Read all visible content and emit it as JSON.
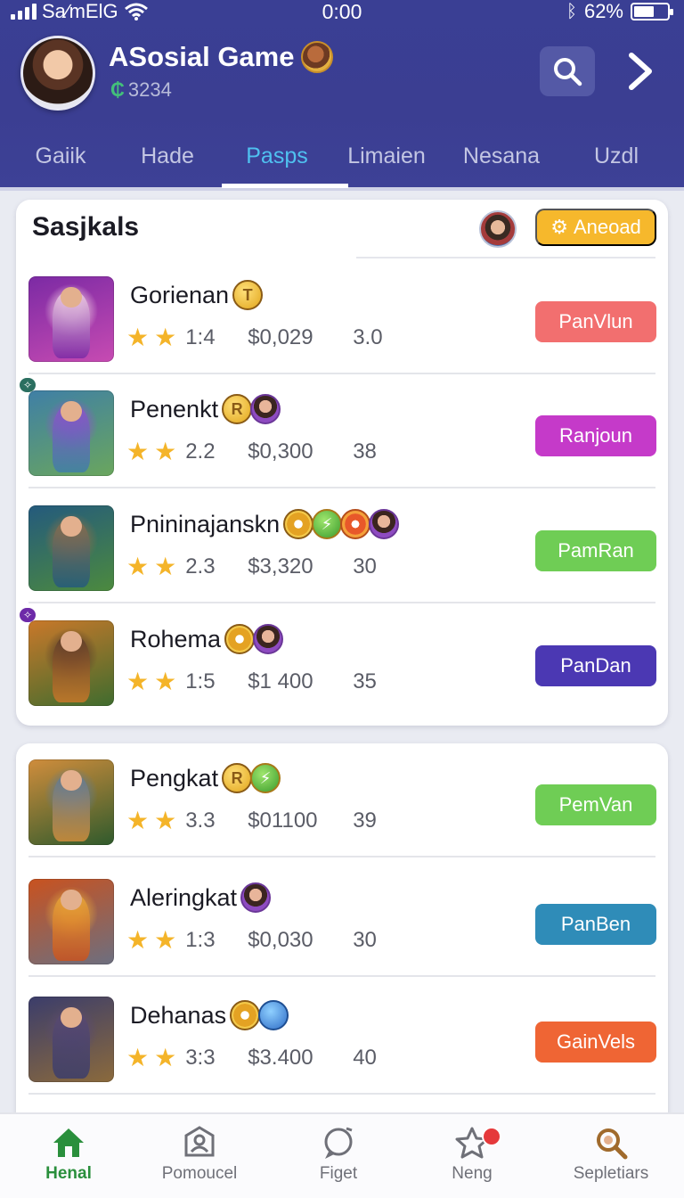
{
  "status_bar": {
    "carrier": "Sa∕mElG",
    "time": "0:00",
    "battery_pct_text": "62%",
    "battery_level": 0.62
  },
  "header": {
    "app_title": "ASosial Game",
    "credits": "3234",
    "credits_icon": "gem-icon"
  },
  "tabs": [
    "Gaiik",
    "Hade",
    "Pasps",
    "Limaien",
    "Nesana",
    "Uzdl"
  ],
  "active_tab": 2,
  "section": {
    "title": "Sasjkals",
    "reload_label": "Aneoad"
  },
  "colors": {
    "header_bg": "#3a3f94",
    "active_tab": "#4fc1f0",
    "reload": "#f6b82c",
    "active_nav": "#2a8f3c"
  },
  "games": [
    {
      "name": "Gorienan",
      "badges": [
        "gold"
      ],
      "badge_text": [
        "T"
      ],
      "rating": "1:4",
      "price": "$0,029",
      "count": "3.0",
      "button": "PanVlun",
      "button_color": "#f26f6f",
      "thumb": [
        "#7b2aa4",
        "#c74bb2",
        "#f0d0e4"
      ],
      "tag": ""
    },
    {
      "name": "Penenkt",
      "badges": [
        "gold",
        "purple"
      ],
      "badge_text": [
        "R",
        ""
      ],
      "rating": "2.2",
      "price": "$0,300",
      "count": "38",
      "button": "Ranjoun",
      "button_color": "#c53ac9",
      "thumb": [
        "#3f7fa6",
        "#6aa65d",
        "#8d53c8"
      ],
      "tag": "gr"
    },
    {
      "name": "Pnininajanskn",
      "badges": [
        "ring",
        "green",
        "orange",
        "purple"
      ],
      "badge_text": [
        "",
        "⚡",
        "",
        ""
      ],
      "rating": "2.3",
      "price": "$3,320",
      "count": "30",
      "button": "PamRan",
      "button_color": "#6fcd55",
      "thumb": [
        "#245a7d",
        "#4c8a3e",
        "#8a6d4c"
      ],
      "tag": ""
    },
    {
      "name": "Rohema",
      "badges": [
        "ring",
        "purple"
      ],
      "badge_text": [
        "",
        ""
      ],
      "rating": "1:5",
      "price": "$1 400",
      "count": "35",
      "button": "PanDan",
      "button_color": "#4b38b3",
      "thumb": [
        "#c9782a",
        "#3f6c2e",
        "#5b3b2a"
      ],
      "tag": "pu"
    },
    {
      "name": "Pengkat",
      "badges": [
        "gold",
        "green"
      ],
      "badge_text": [
        "R",
        "⚡"
      ],
      "rating": "3.3",
      "price": "$01100",
      "count": "39",
      "button": "PemVan",
      "button_color": "#6fcd55",
      "thumb": [
        "#d08d3c",
        "#2f5a2c",
        "#5e7a96"
      ],
      "tag": ""
    },
    {
      "name": "Aleringkat",
      "badges": [
        "purple"
      ],
      "badge_text": [
        ""
      ],
      "rating": "1:3",
      "price": "$0,030",
      "count": "30",
      "button": "PanBen",
      "button_color": "#2f8cb8",
      "thumb": [
        "#c9521f",
        "#6c6f80",
        "#e7a83a"
      ],
      "tag": ""
    },
    {
      "name": "Dehanas",
      "badges": [
        "ring",
        "blue"
      ],
      "badge_text": [
        "",
        ""
      ],
      "rating": "3:3",
      "price": "$3.400",
      "count": "40",
      "button": "GainVels",
      "button_color": "#ef6534",
      "thumb": [
        "#3b3d6b",
        "#8b6a3c",
        "#5a4a70"
      ],
      "tag": ""
    }
  ],
  "bottom_nav": [
    {
      "label": "Henal",
      "icon": "home-icon",
      "active": true
    },
    {
      "label": "Pomoucel",
      "icon": "profile-badge-icon",
      "active": false
    },
    {
      "label": "Figet",
      "icon": "chat-bubble-icon",
      "active": false
    },
    {
      "label": "Neng",
      "icon": "notification-star-icon",
      "active": false
    },
    {
      "label": "Sepletiars",
      "icon": "magnifier-icon",
      "active": false
    }
  ]
}
